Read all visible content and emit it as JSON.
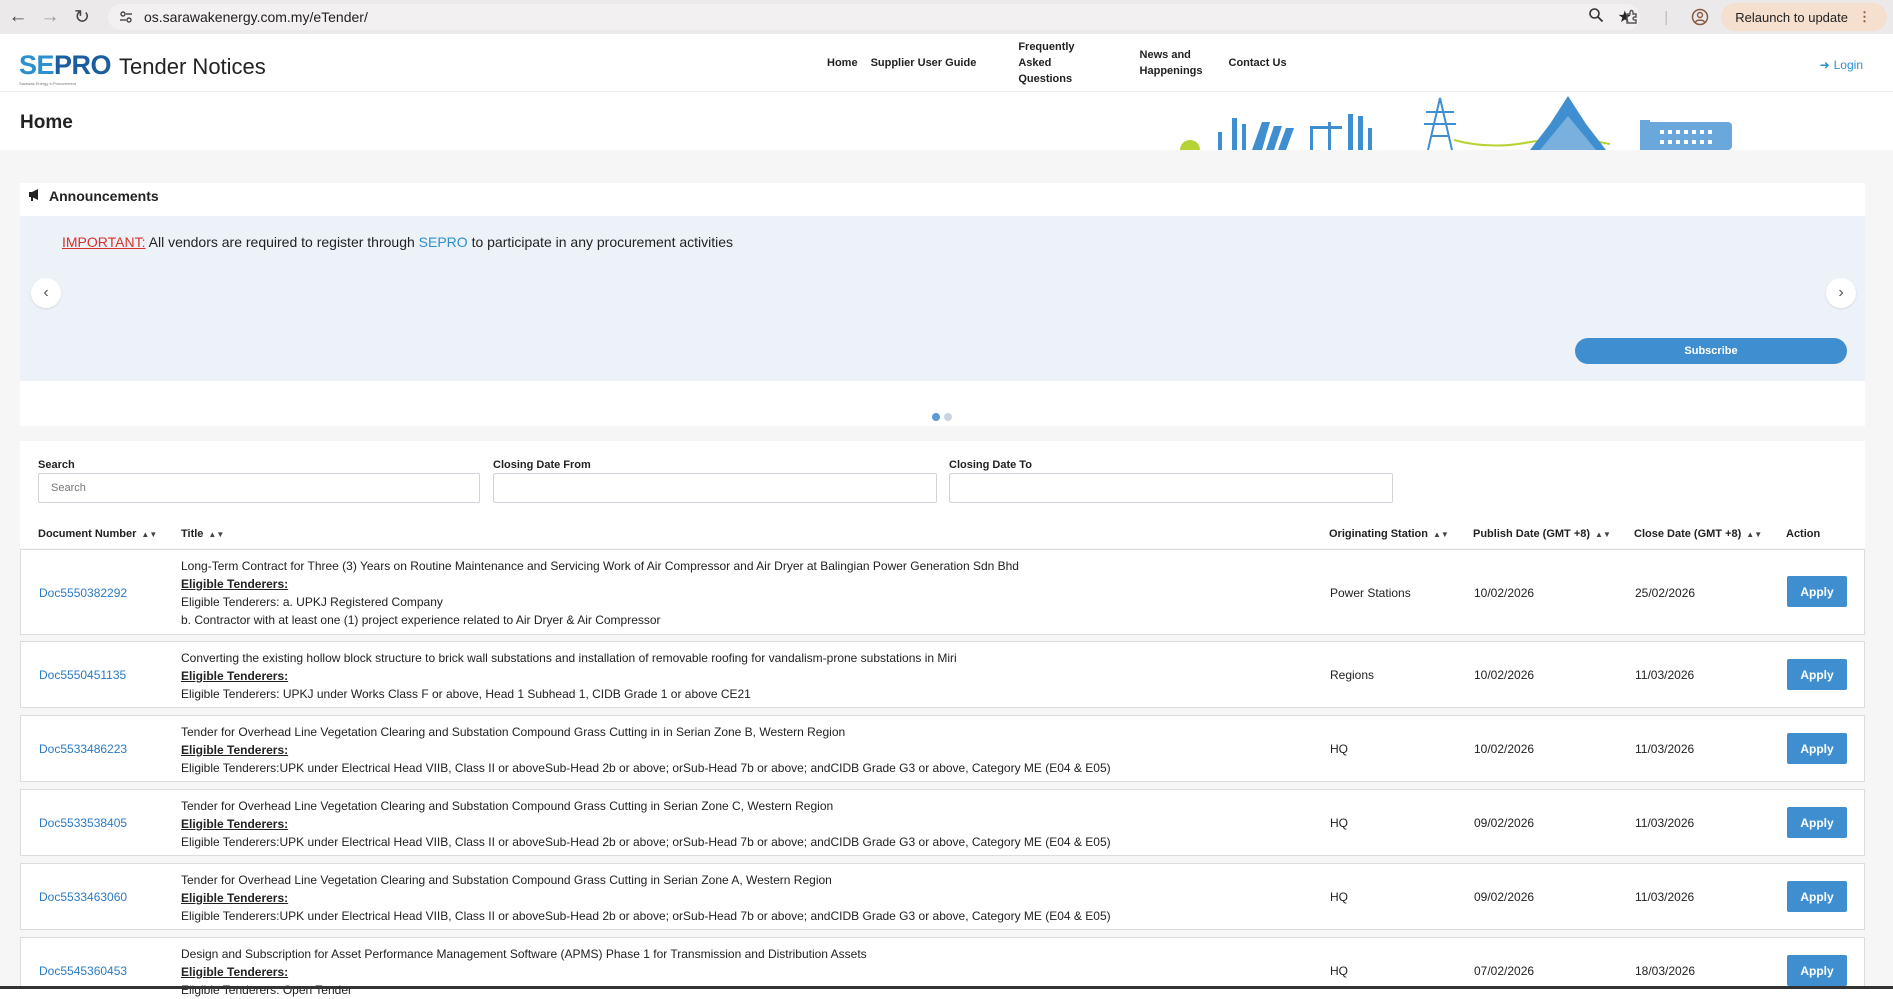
{
  "browser": {
    "url": "os.sarawakenergy.com.my/eTender/",
    "relaunch_label": "Relaunch to update"
  },
  "header": {
    "logo_se": "SE",
    "logo_pro": "PRO",
    "logo_sub": "Sarawak Energy e-Procurement",
    "site_title": "Tender Notices",
    "nav": {
      "home": "Home",
      "guide": "Supplier User Guide",
      "faq_1": "Frequently",
      "faq_2": "Asked",
      "faq_3": "Questions",
      "news_1": "News and",
      "news_2": "Happenings",
      "contact": "Contact Us"
    },
    "login": "Login"
  },
  "hero": {
    "title": "Home"
  },
  "announcements": {
    "heading": "Announcements",
    "important": "IMPORTANT:",
    "text_before": "All vendors are required to register through",
    "sepro": "SEPRO",
    "text_after": "to participate in any procurement activities",
    "subscribe_label": "Subscribe",
    "slides_count": 2,
    "active_slide": 1
  },
  "filters": {
    "search_label": "Search",
    "search_placeholder": "Search",
    "from_label": "Closing Date From",
    "to_label": "Closing Date To"
  },
  "table": {
    "columns": {
      "doc": "Document Number",
      "title": "Title",
      "station": "Originating Station",
      "publish": "Publish Date (GMT +8)",
      "close": "Close Date (GMT +8)",
      "action": "Action"
    },
    "eligible_heading": "Eligible Tenderers:",
    "apply_label": "Apply",
    "rows": [
      {
        "doc": "Doc5550382292",
        "title": "Long-Term Contract for Three (3) Years on Routine Maintenance and Servicing Work of Air Compressor and Air Dryer at Balingian Power Generation Sdn Bhd",
        "line1": "Eligible Tenderers: a. UPKJ Registered Company",
        "line2": "b. Contractor with at least one (1) project experience related to Air Dryer & Air Compressor",
        "station": "Power Stations",
        "publish": "10/02/2026",
        "close": "25/02/2026"
      },
      {
        "doc": "Doc5550451135",
        "title": "Converting the existing hollow block structure to brick wall substations and installation of removable roofing for vandalism-prone substations in Miri",
        "line1": "Eligible Tenderers: UPKJ under Works Class F or above, Head 1 Subhead 1, CIDB Grade 1 or above CE21",
        "station": "Regions",
        "publish": "10/02/2026",
        "close": "11/03/2026"
      },
      {
        "doc": "Doc5533486223",
        "title": "Tender for Overhead Line Vegetation Clearing and Substation Compound Grass Cutting in in Serian Zone B, Western Region",
        "line1": "Eligible Tenderers:UPK under Electrical Head VIIB, Class II or aboveSub-Head 2b or above; orSub-Head 7b or above; andCIDB Grade G3 or above, Category ME (E04 & E05)",
        "station": "HQ",
        "publish": "10/02/2026",
        "close": "11/03/2026"
      },
      {
        "doc": "Doc5533538405",
        "title": "Tender for Overhead Line Vegetation Clearing and Substation Compound Grass Cutting in Serian Zone C, Western Region",
        "line1": "Eligible Tenderers:UPK under Electrical Head VIIB, Class II or aboveSub-Head 2b or above; orSub-Head 7b or above; andCIDB Grade G3 or above, Category ME (E04 & E05)",
        "station": "HQ",
        "publish": "09/02/2026",
        "close": "11/03/2026"
      },
      {
        "doc": "Doc5533463060",
        "title": "Tender for Overhead Line Vegetation Clearing and Substation Compound Grass Cutting in Serian Zone A, Western Region",
        "line1": "Eligible Tenderers:UPK under Electrical Head VIIB, Class II or aboveSub-Head 2b or above; orSub-Head 7b or above; andCIDB Grade G3 or above, Category ME (E04 & E05)",
        "station": "HQ",
        "publish": "09/02/2026",
        "close": "11/03/2026"
      },
      {
        "doc": "Doc5545360453",
        "title": "Design and Subscription for Asset Performance Management Software (APMS) Phase 1 for Transmission and Distribution Assets",
        "line1": "Eligible Tenderers: Open Tender",
        "station": "HQ",
        "publish": "07/02/2026",
        "close": "18/03/2026"
      }
    ]
  }
}
